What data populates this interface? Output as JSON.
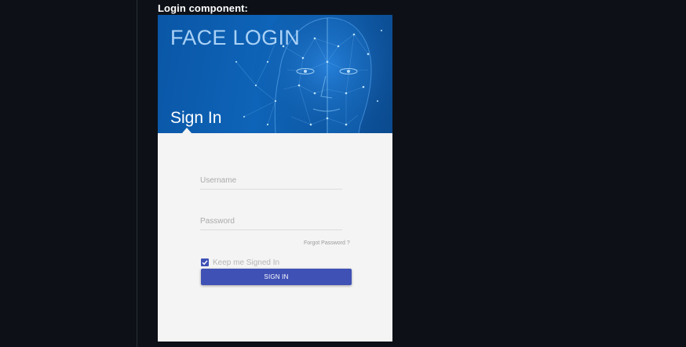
{
  "heading": "Login component:",
  "login_card": {
    "banner": {
      "title": "FACE LOGIN",
      "subtitle": "Sign In",
      "image_icon": "face-scan-illustration"
    },
    "form": {
      "username_placeholder": "Username",
      "username_value": "",
      "password_placeholder": "Password",
      "password_value": "",
      "forgot_password": "Forgot Password ?",
      "remember_me_label": "Keep me Signed In",
      "remember_me_checked": true,
      "sign_in_button": "SIGN IN"
    }
  },
  "colors": {
    "page_background": "#0d1117",
    "banner_blue": "#0e64b8",
    "banner_title": "#a9d1f6",
    "card_background": "#f4f4f4",
    "button_indigo": "#3f51b5"
  }
}
